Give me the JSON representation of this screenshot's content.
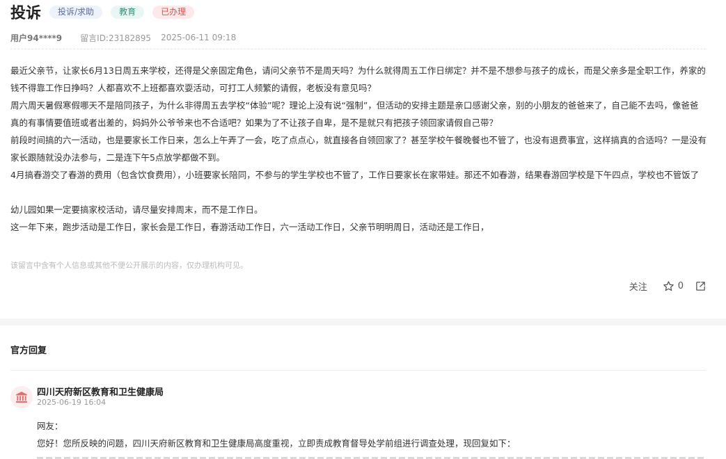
{
  "post": {
    "title": "投诉",
    "tags": {
      "type": "投诉/求助",
      "field": "教育",
      "status": "已办理"
    },
    "user": "用户94****9",
    "message_id": "留言ID:23182895",
    "datetime": "2025-06-11 09:18",
    "paragraphs": [
      "最近父亲节，让家长6月13日周五来学校，还得是父亲固定角色，请问父亲节不是周天吗？为什么就得周五工作日绑定？并不是不想参与孩子的成长，而是父亲多是全职工作，养家的钱不得靠工作日挣吗？人都喜欢不上班都喜欢耍活动，可打工人频繁的请假，老板没有意见吗？",
      "周六周天暑假寒假哪天不是陪同孩子，为什么非得周五去学校“体验”呢？理论上没有说“强制”，但活动的安排主题是亲口感谢父亲，别的小朋友的爸爸来了，自己能不去吗，像爸爸真的有事情要值班或者出差的，妈妈外公爷爷来也不合适吧？如果为了不让孩子自卑，是不是就只有把孩子领回家请假自己带？",
      "前段时间搞的六一活动，也是要家长工作日来，怎么上午弄了一会，吃了点点心，就直接各自领回家了？甚至学校午餐晚餐也不管了，也没有退费事宜，这样搞真的合适吗？一是没有家长跟随就没办法参与，二是连下午5点放学都做不到。",
      "4月搞春游交了春游的费用（包含饮食费用），小班要家长陪同，不参与的学生学校也不管了，工作日要家长在家带娃。那还不如春游，结果春游回学校是下午四点，学校也不管饭了",
      "",
      "幼儿园如果一定要搞家校活动，请尽量安排周末，而不是工作日。",
      "这一年下来，跑步活动是工作日，家长会是工作日，春游活动工作日，六一活动工作日，父亲节明明周日，活动还是工作日，"
    ],
    "notice": "该留言中含有个人信息或其他不便公开展示的内容，仅办理机构可见。",
    "actions": {
      "follow": "关注",
      "like_count": "0"
    }
  },
  "reply": {
    "heading": "官方回复",
    "org_name": "四川天府新区教育和卫生健康局",
    "org_time": "2025-06-19 16:04",
    "lines": [
      "网友：",
      "您好！您所反映的问题，四川天府新区教育和卫生健康局高度重视，立即责成教育督导处学前组进行调查处理，现回复如下："
    ]
  },
  "colors": {
    "tag_type_bg": "#eef2fb",
    "tag_field_bg": "#eaf6f3",
    "tag_status_bg": "#fde9e9",
    "status_red": "#d9534f",
    "avatar_bg": "#fdeeee"
  },
  "icons": [
    "star-icon",
    "share-icon",
    "government-building-icon"
  ]
}
